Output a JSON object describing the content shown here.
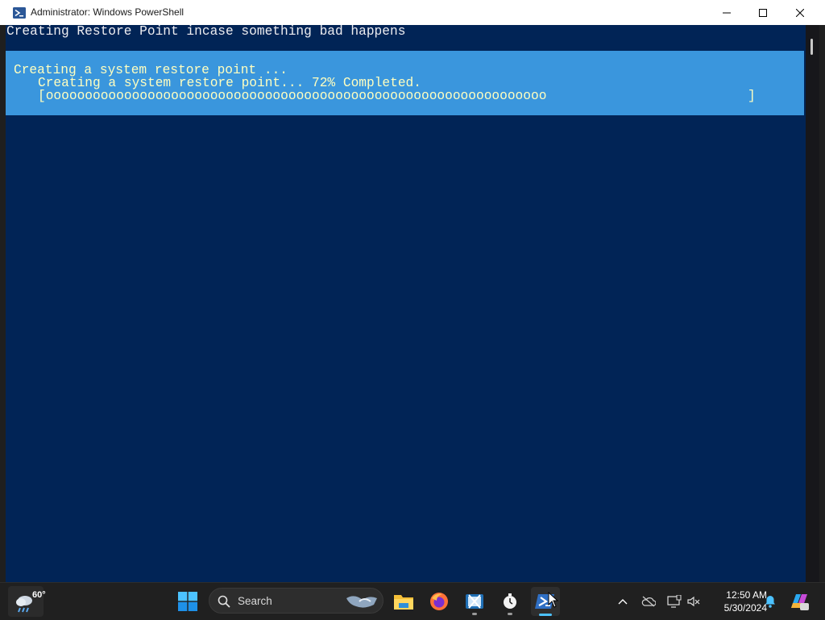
{
  "window": {
    "title": "Administrator: Windows PowerShell",
    "icon": "powershell-icon",
    "controls": [
      "minimize-icon",
      "maximize-icon",
      "close-icon"
    ]
  },
  "console": {
    "lines": [
      "Creating Restore Point incase something bad happens"
    ],
    "progress": {
      "activity": "Creating a system restore point ...",
      "status": "Creating a system restore point... 72% Completed.",
      "bar": "[oooooooooooooooooooooooooooooooooooooooooooooooooooooooooooooooo",
      "bar_end": "]",
      "percent": 72
    },
    "colors": {
      "background": "#012456",
      "progress_background": "#3a96dd",
      "progress_text": "#ffffc0",
      "text": "#eeedf0"
    }
  },
  "taskbar": {
    "weather": {
      "temperature": "60°",
      "icon": "weather-rain-icon"
    },
    "start_icon": "windows-start-icon",
    "search": {
      "label": "Search",
      "icon": "search-icon"
    },
    "apps": [
      {
        "name": "file-explorer-icon"
      },
      {
        "name": "firefox-icon"
      },
      {
        "name": "snipping-tool-icon"
      },
      {
        "name": "clock-app-icon"
      },
      {
        "name": "powershell-icon"
      }
    ],
    "tray": [
      "chevron-up-icon",
      "onedrive-icon",
      "network-icon",
      "volume-muted-icon"
    ],
    "clock": {
      "time": "12:50 AM",
      "date": "5/30/2024"
    },
    "notification_icon": "bell-icon",
    "copilot_icon": "copilot-icon"
  }
}
